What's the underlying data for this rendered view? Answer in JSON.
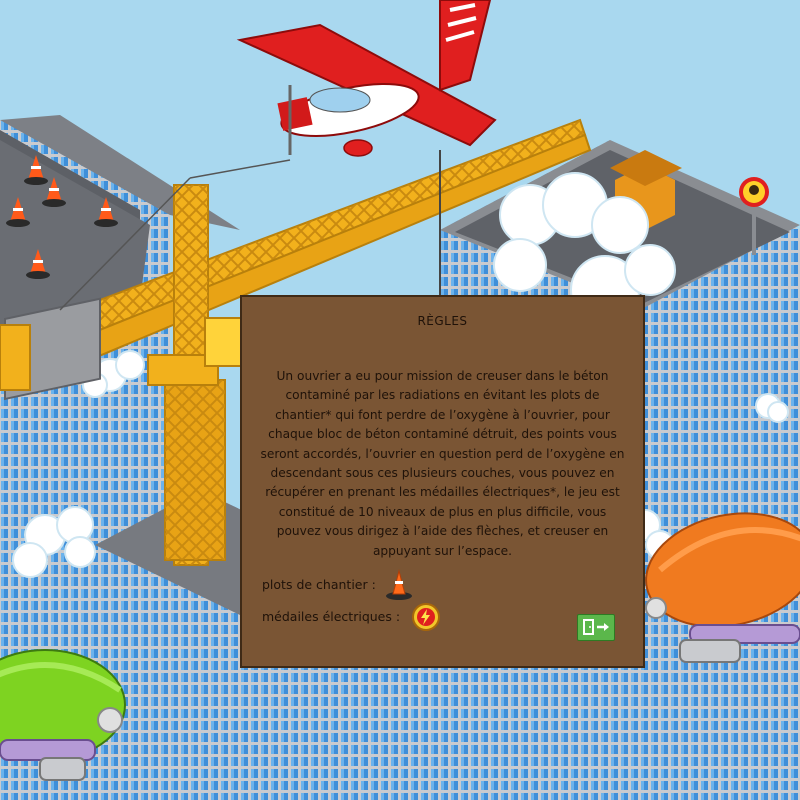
{
  "dialog": {
    "title": "RÈGLES",
    "body": "Un ouvrier a eu pour mission de creuser dans le béton contaminé par les radiations en évitant les plots de chantier* qui font perdre de l’oxygène à l’ouvrier, pour chaque bloc de béton contaminé détruit, des points vous seront accordés, l’ouvrier en question perd de l’oxygène en descendant sous ces plusieurs couches, vous pouvez en récupérer en prenant les médailles électriques*, le jeu est constitué de 10 niveaux de plus en plus difficile, vous pouvez vous dirigez à l’aide des flèches, et creuser en appuyant sur l’espace.",
    "legend_cone_label": "plots de chantier :",
    "legend_medal_label": "médailes électriques :",
    "cone_icon": "traffic-cone-icon",
    "medal_icon": "electric-medal-icon",
    "exit_icon": "exit-door-icon"
  },
  "colors": {
    "sky": "#a9d8ef",
    "panel": "#7a5534",
    "panel_border": "#3f2a16",
    "exit_button": "#5bb74b",
    "crane": "#f2b11c",
    "plane": "#e01f1f",
    "blimp_green": "#7ed321",
    "blimp_orange": "#f07a1f"
  }
}
